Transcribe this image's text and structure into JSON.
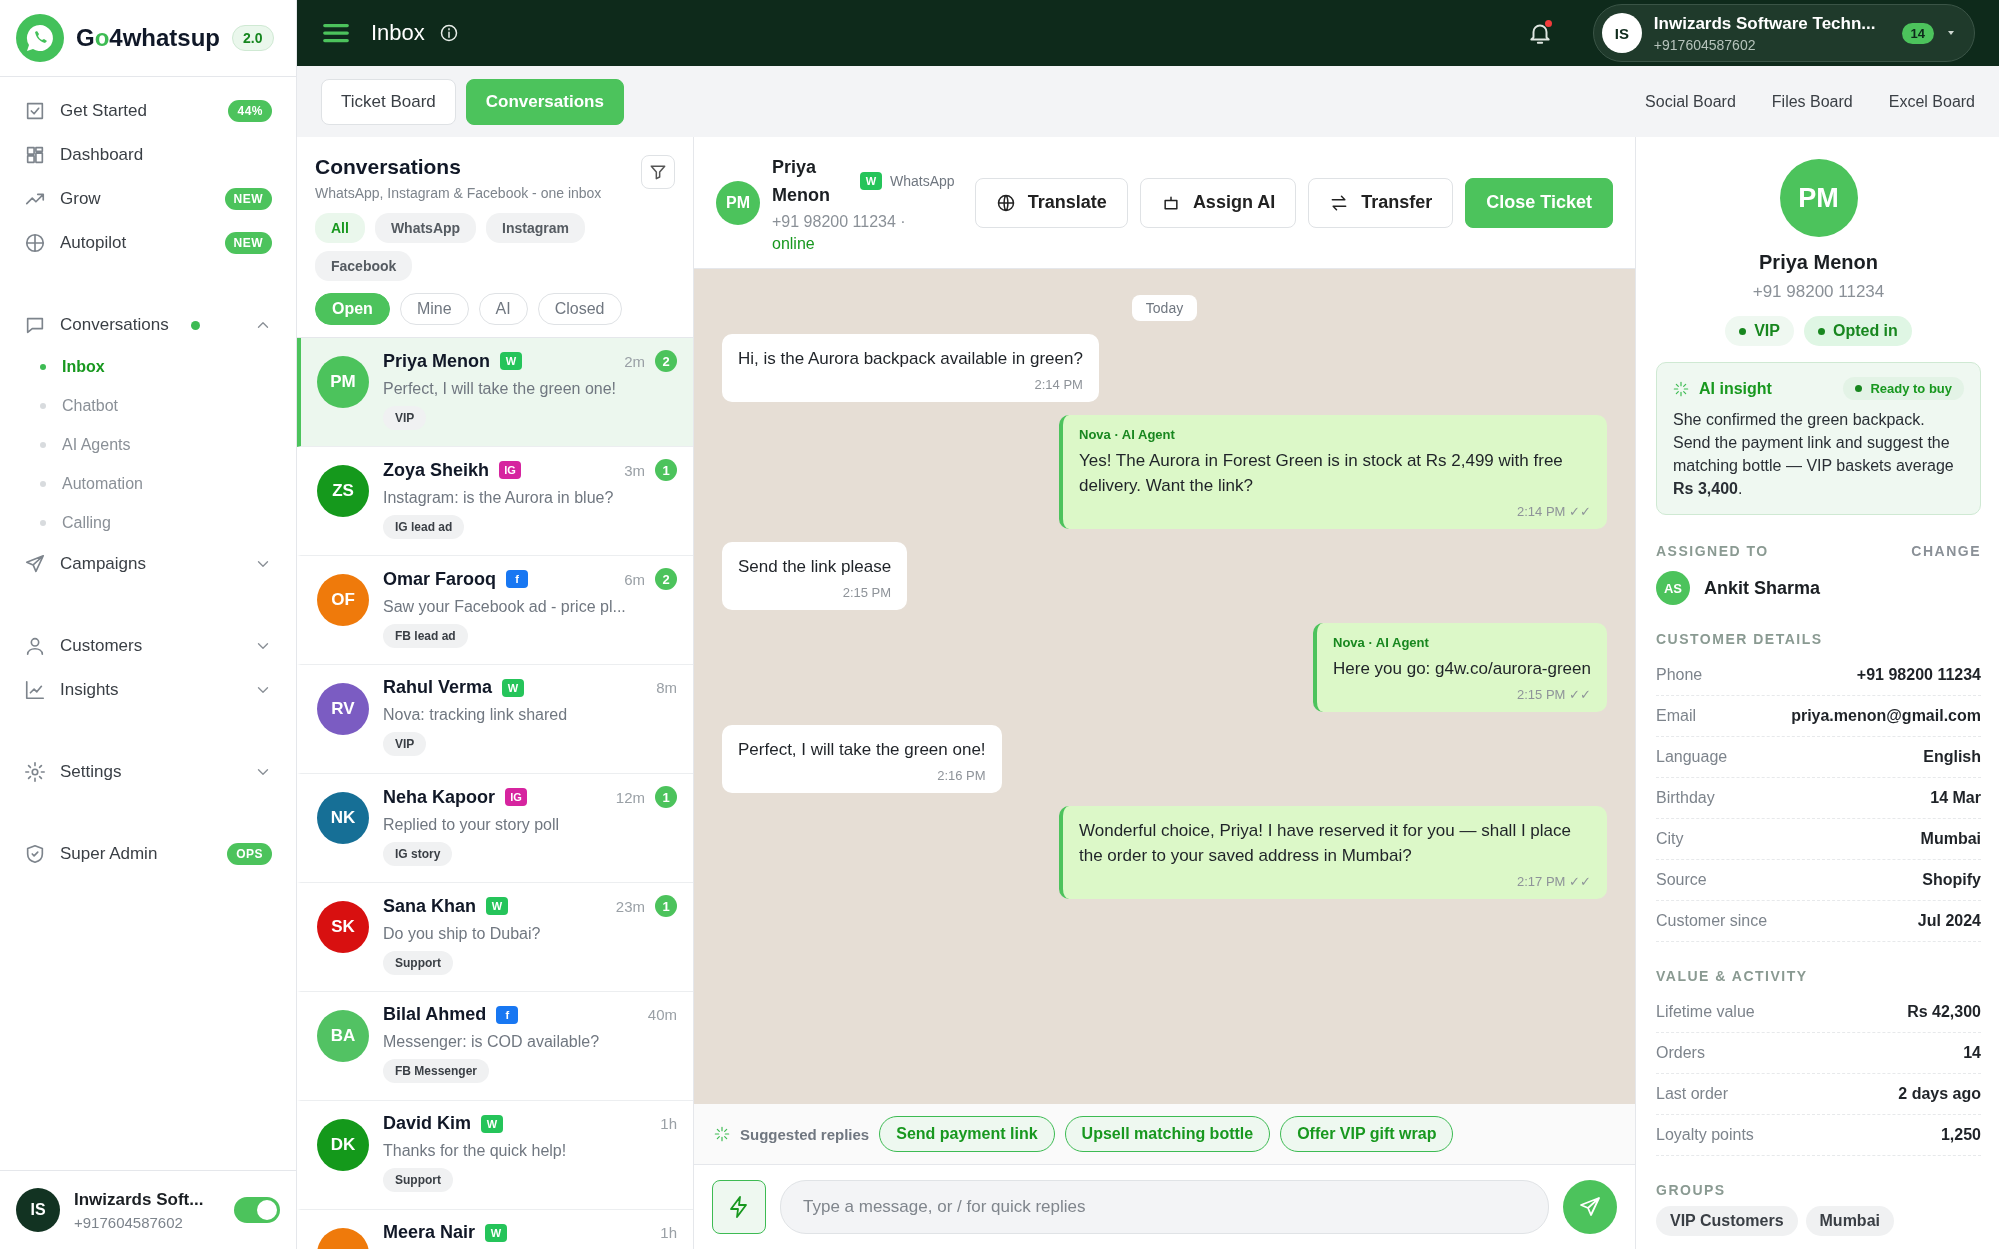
{
  "sidebar": {
    "logo": {
      "name": "Go4whatsup",
      "version": "2.0"
    },
    "groups": [
      [
        {
          "label": "Get Started",
          "badge": "44%"
        },
        {
          "label": "Dashboard"
        },
        {
          "label": "Grow",
          "badge": "NEW"
        },
        {
          "label": "Autopilot",
          "badge": "NEW"
        }
      ],
      [
        {
          "label": "Conversations",
          "dot": true,
          "expanded": true,
          "children": [
            {
              "label": "Inbox",
              "selected": true
            },
            {
              "label": "Chatbot",
              "selected": false
            },
            {
              "label": "AI Agents",
              "selected": false
            },
            {
              "label": "Automation",
              "selected": false
            },
            {
              "label": "Calling",
              "selected": false
            }
          ]
        },
        {
          "label": "Campaigns",
          "expanded": false
        }
      ],
      [
        {
          "label": "Customers",
          "expanded": false
        },
        {
          "label": "Insights",
          "expanded": false
        }
      ],
      [
        {
          "label": "Settings",
          "expanded": false
        }
      ],
      [
        {
          "label": "Super Admin",
          "badge": "OPS"
        }
      ]
    ],
    "user": {
      "initials": "IS",
      "name": "Inwizards Soft...",
      "phone": "+917604587602",
      "online": true
    }
  },
  "topbar": {
    "title": "Inbox",
    "notification": true,
    "account": {
      "initials": "IS",
      "name": "Inwizards Software Techn...",
      "phone": "+917604587602",
      "count": "14"
    }
  },
  "tabs": [
    {
      "label": "Ticket Board",
      "selected": false
    },
    {
      "label": "Conversations",
      "selected": true
    }
  ],
  "board_links": [
    "Social Board",
    "Files Board",
    "Excel Board"
  ],
  "conversation_list": {
    "title": "Conversations",
    "subtitle": "WhatsApp, Instagram & Facebook - one inbox",
    "channel_filters": [
      {
        "label": "All",
        "selected": true
      },
      {
        "label": "WhatsApp",
        "selected": false
      },
      {
        "label": "Instagram",
        "selected": false
      },
      {
        "label": "Facebook",
        "selected": false
      }
    ],
    "status_filters": [
      {
        "label": "Open",
        "selected": true
      },
      {
        "label": "Mine",
        "selected": false
      },
      {
        "label": "AI",
        "selected": false
      },
      {
        "label": "Closed",
        "selected": false
      }
    ],
    "items": [
      {
        "initials": "PM",
        "color": "#4cc35c",
        "name": "Priya Menon",
        "kind": "whatsapp",
        "channel_label": "W",
        "time": "2m",
        "preview": "Perfect, I will take the green one!",
        "tag": "VIP",
        "unread": "2",
        "selected": true
      },
      {
        "initials": "ZS",
        "color": "#15991c",
        "name": "Zoya Sheikh",
        "kind": "instagram",
        "channel_label": "IG",
        "time": "3m",
        "preview": "Instagram: is the Aurora in blue?",
        "tag": "IG lead ad",
        "unread": "1",
        "selected": false
      },
      {
        "initials": "OF",
        "color": "#ef7a0b",
        "name": "Omar Farooq",
        "kind": "facebook",
        "channel_label": "f",
        "time": "6m",
        "preview": "Saw your Facebook ad - price pl...",
        "tag": "FB lead ad",
        "unread": "2",
        "selected": false
      },
      {
        "initials": "RV",
        "color": "#7b5cc2",
        "name": "Rahul Verma",
        "kind": "whatsapp",
        "channel_label": "W",
        "time": "8m",
        "preview": "Nova: tracking link shared",
        "tag": "VIP",
        "selected": false
      },
      {
        "initials": "NK",
        "color": "#166f96",
        "name": "Neha Kapoor",
        "kind": "instagram",
        "channel_label": "IG",
        "time": "12m",
        "preview": "Replied to your story poll",
        "tag": "IG story",
        "unread": "1",
        "selected": false
      },
      {
        "initials": "SK",
        "color": "#d81010",
        "name": "Sana Khan",
        "kind": "whatsapp",
        "channel_label": "W",
        "time": "23m",
        "preview": "Do you ship to Dubai?",
        "tag": "Support",
        "unread": "1",
        "selected": false
      },
      {
        "initials": "BA",
        "color": "#52c263",
        "name": "Bilal Ahmed",
        "kind": "facebook",
        "channel_label": "f",
        "time": "40m",
        "preview": "Messenger: is COD available?",
        "tag": "FB Messenger",
        "selected": false
      },
      {
        "initials": "DK",
        "color": "#14991b",
        "name": "David Kim",
        "kind": "whatsapp",
        "channel_label": "W",
        "time": "1h",
        "preview": "Thanks for the quick help!",
        "tag": "Support",
        "selected": false
      },
      {
        "color": "#ef7a0b",
        "name": "Meera Nair",
        "kind": "whatsapp",
        "channel_label": "W",
        "time": "1h",
        "selected": false
      }
    ]
  },
  "chat": {
    "contact": {
      "initials": "PM",
      "name": "Priya Menon",
      "kind": "whatsapp",
      "channel_label": "W",
      "channel_name": "WhatsApp",
      "phone": "+91 98200 11234 ·",
      "status": "online"
    },
    "actions": [
      {
        "label": "Translate",
        "kind": "translate"
      },
      {
        "label": "Assign AI",
        "kind": "assign"
      },
      {
        "label": "Transfer",
        "kind": "transfer"
      },
      {
        "label": "Close Ticket",
        "kind": "primary"
      }
    ],
    "day": "Today",
    "messages": [
      {
        "kind": "in",
        "text": "Hi, is the Aurora backpack available in green?",
        "time": "2:14 PM"
      },
      {
        "kind": "out",
        "sender": "Nova · AI Agent",
        "text": "Yes! The Aurora in Forest Green is in stock at Rs 2,499 with free delivery. Want the link?",
        "time": "2:14 PM",
        "ticks": "✓✓"
      },
      {
        "kind": "in",
        "text": "Send the link please",
        "time": "2:15 PM"
      },
      {
        "kind": "out",
        "sender": "Nova · AI Agent",
        "text": "Here you go: g4w.co/aurora-green",
        "time": "2:15 PM",
        "ticks": "✓✓"
      },
      {
        "kind": "in",
        "text": "Perfect, I will take the green one!",
        "time": "2:16 PM"
      },
      {
        "kind": "out",
        "text": "Wonderful choice, Priya! I have reserved it for you — shall I place the order to your saved address in Mumbai?",
        "time": "2:17 PM",
        "ticks": "✓✓"
      }
    ],
    "suggested": {
      "label": "Suggested replies",
      "replies": [
        "Send payment link",
        "Upsell matching bottle",
        "Offer VIP gift wrap"
      ]
    },
    "composer": {
      "placeholder": "Type a message, or / for quick replies"
    }
  },
  "profile": {
    "initials": "PM",
    "name": "Priya Menon",
    "phone": "+91 98200 11234",
    "tags": [
      "VIP",
      "Opted in"
    ],
    "insight": {
      "title": "AI insight",
      "badge": "Ready to buy",
      "text": "She confirmed the green backpack. Send the payment link and suggest the matching bottle — VIP baskets average **Rs 3,400**."
    },
    "assigned": {
      "label": "ASSIGNED TO",
      "action": "CHANGE",
      "initials": "AS",
      "name": "Ankit Sharma"
    },
    "sections": [
      {
        "title": "CUSTOMER DETAILS",
        "rows": [
          {
            "label": "Phone",
            "value": "+91 98200 11234"
          },
          {
            "label": "Email",
            "value": "priya.menon@gmail.com"
          },
          {
            "label": "Language",
            "value": "English"
          },
          {
            "label": "Birthday",
            "value": "14 Mar"
          },
          {
            "label": "City",
            "value": "Mumbai"
          },
          {
            "label": "Source",
            "value": "Shopify"
          },
          {
            "label": "Customer since",
            "value": "Jul 2024"
          }
        ]
      },
      {
        "title": "VALUE & ACTIVITY",
        "rows": [
          {
            "label": "Lifetime value",
            "value": "Rs 42,300"
          },
          {
            "label": "Orders",
            "value": "14"
          },
          {
            "label": "Last order",
            "value": "2 days ago"
          },
          {
            "label": "Loyalty points",
            "value": "1,250"
          }
        ]
      }
    ],
    "groups": {
      "title": "GROUPS",
      "items": [
        "VIP Customers",
        "Mumbai"
      ]
    }
  }
}
